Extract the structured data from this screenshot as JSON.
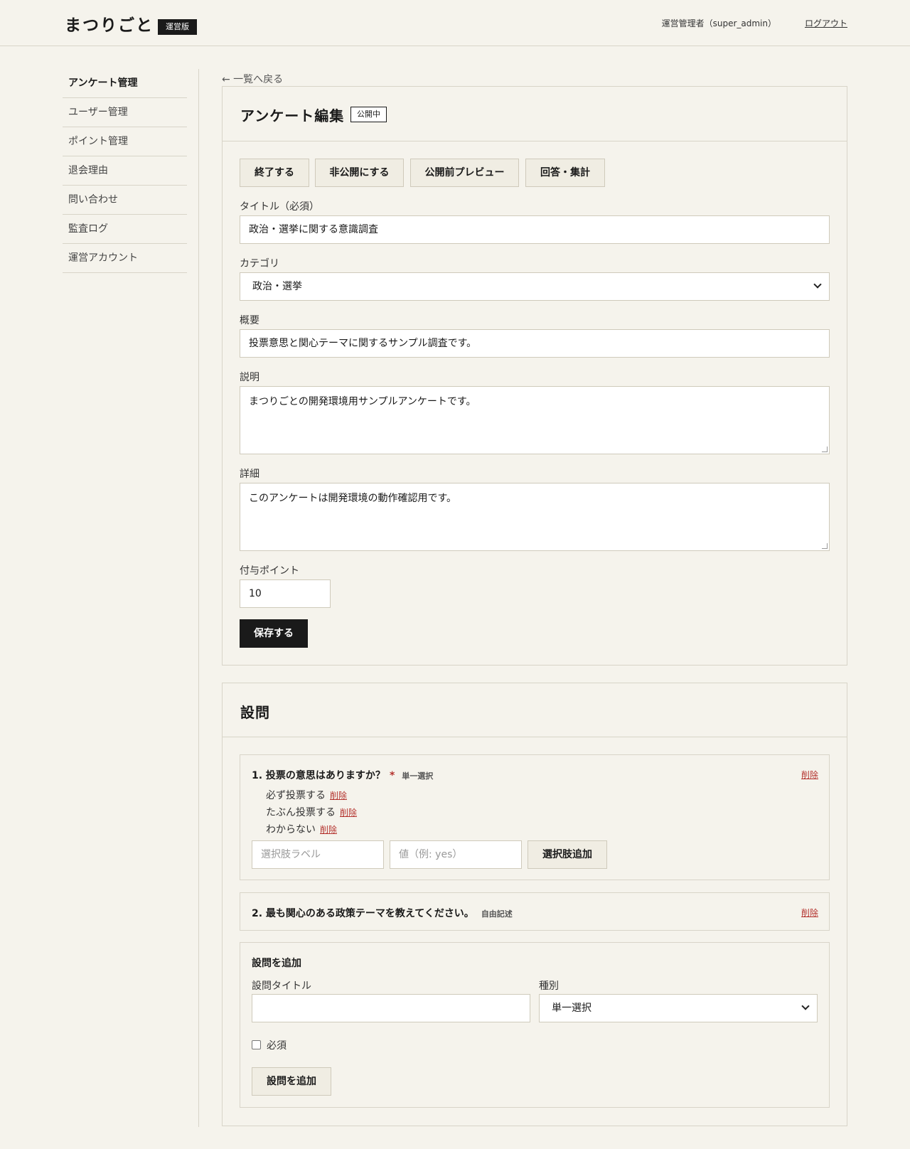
{
  "header": {
    "logo": "まつりごと",
    "logo_badge": "運営版",
    "admin_name": "運営管理者（super_admin）",
    "logout_label": "ログアウト"
  },
  "sidebar": {
    "items": [
      {
        "label": "アンケート管理",
        "active": true
      },
      {
        "label": "ユーザー管理"
      },
      {
        "label": "ポイント管理"
      },
      {
        "label": "退会理由"
      },
      {
        "label": "問い合わせ"
      },
      {
        "label": "監査ログ"
      },
      {
        "label": "運営アカウント"
      }
    ]
  },
  "back_link": "← 一覧へ戻る",
  "edit_panel": {
    "title": "アンケート編集",
    "status_badge": "公開中",
    "actions": [
      "終了する",
      "非公開にする",
      "公開前プレビュー",
      "回答・集計"
    ],
    "title_label": "タイトル（必須）",
    "title_value": "政治・選挙に関する意識調査",
    "category_label": "カテゴリ",
    "category_value": "政治・選挙",
    "summary_label": "概要",
    "summary_value": "投票意思と関心テーマに関するサンプル調査です。",
    "description_label": "説明",
    "description_value": "まつりごとの開発環境用サンプルアンケートです。",
    "detail_label": "詳細",
    "detail_value": "このアンケートは開発環境の動作確認用です。",
    "points_label": "付与ポイント",
    "points_value": "10",
    "save_label": "保存する"
  },
  "questions_panel": {
    "title": "設問",
    "questions": [
      {
        "title": "1. 投票の意思はありますか？",
        "required_mark": "*",
        "type": "単一選択",
        "delete_label": "削除",
        "options": [
          {
            "label": "必ず投票する",
            "delete_label": "削除"
          },
          {
            "label": "たぶん投票する",
            "delete_label": "削除"
          },
          {
            "label": "わからない",
            "delete_label": "削除"
          }
        ],
        "option_label_placeholder": "選択肢ラベル",
        "option_value_placeholder": "値（例: yes）",
        "add_option_label": "選択肢追加"
      },
      {
        "title": "2. 最も関心のある政策テーマを教えてください。",
        "type": "自由記述",
        "delete_label": "削除"
      }
    ],
    "add_question": {
      "heading": "設問を追加",
      "title_label": "設問タイトル",
      "title_value": "",
      "type_label": "種別",
      "type_value": "単一選択",
      "required_label": "必須",
      "required_checked": false,
      "submit_label": "設問を追加"
    }
  }
}
